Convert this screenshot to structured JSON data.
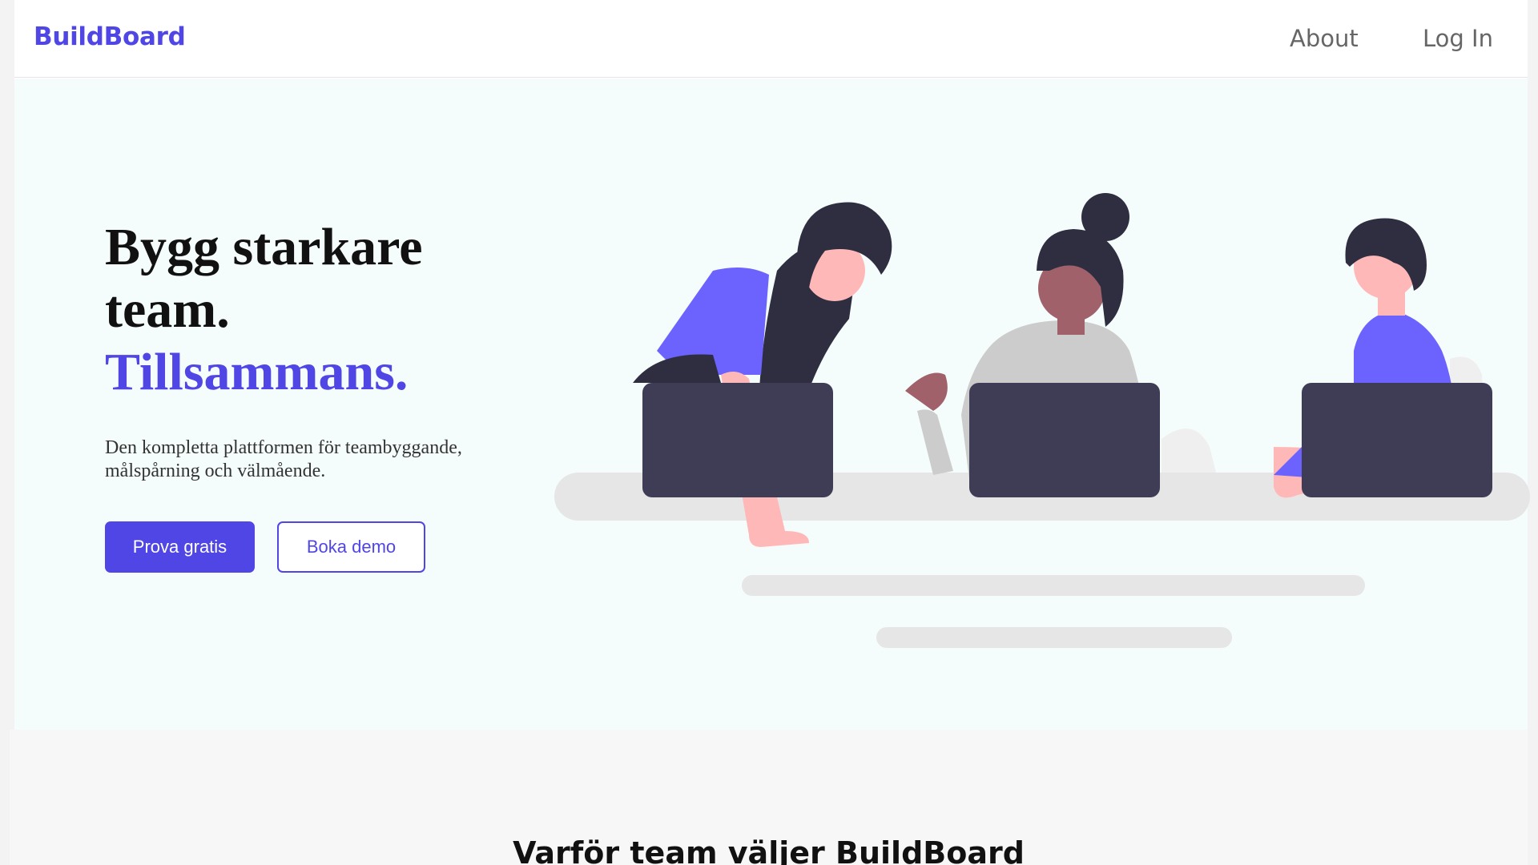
{
  "nav": {
    "brand": "BuildBoard",
    "links": [
      {
        "label": "About"
      },
      {
        "label": "Log In"
      }
    ]
  },
  "hero": {
    "title_line1": "Bygg starkare",
    "title_line2": "team.",
    "title_accent": "Tillsammans.",
    "subtitle": "Den kompletta plattformen för teambyggande, målspårning och välmående.",
    "primary_cta": "Prova gratis",
    "secondary_cta": "Boka demo"
  },
  "features": {
    "title": "Varför team väljer BuildBoard"
  },
  "colors": {
    "accent": "#4f46e5",
    "hero_bg": "#f5fdfc",
    "illustration_purple": "#6c63ff",
    "laptop": "#3f3d56",
    "hair": "#2f2e41",
    "skin_light": "#ffb8b8",
    "skin_dark": "#a0616a",
    "shirt_grey": "#cccccc",
    "desk": "#e6e6e6"
  },
  "icons": [
    "team-illustration"
  ]
}
